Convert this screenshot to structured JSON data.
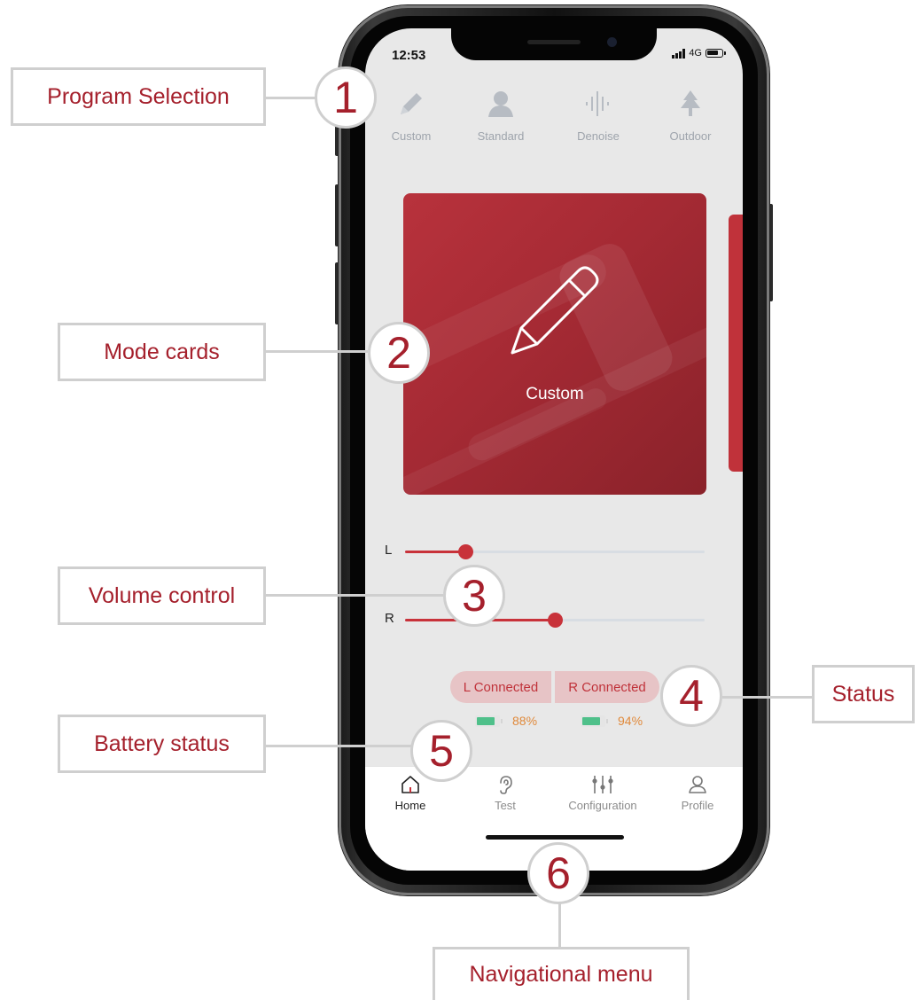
{
  "status_bar": {
    "time": "12:53",
    "network": "4G"
  },
  "programs": [
    {
      "label": "Custom",
      "icon": "pencil-icon"
    },
    {
      "label": "Standard",
      "icon": "person-icon"
    },
    {
      "label": "Denoise",
      "icon": "waveform-icon"
    },
    {
      "label": "Outdoor",
      "icon": "tree-icon"
    }
  ],
  "mode_card": {
    "label": "Custom",
    "icon": "pencil-icon"
  },
  "volume": {
    "left": {
      "label": "L",
      "level": 0.2
    },
    "right": {
      "label": "R",
      "level": 0.5
    }
  },
  "status": {
    "left_label": "L Connected",
    "right_label": "R Connected",
    "left_battery": "88%",
    "right_battery": "94%"
  },
  "nav": [
    {
      "label": "Home",
      "icon": "home-icon",
      "active": true
    },
    {
      "label": "Test",
      "icon": "ear-icon",
      "active": false
    },
    {
      "label": "Configuration",
      "icon": "sliders-icon",
      "active": false
    },
    {
      "label": "Profile",
      "icon": "user-icon",
      "active": false
    }
  ],
  "callouts": {
    "program_selection": {
      "number": "1",
      "label": "Program Selection"
    },
    "mode_cards": {
      "number": "2",
      "label": "Mode cards"
    },
    "volume_control": {
      "number": "3",
      "label": "Volume control"
    },
    "status": {
      "number": "4",
      "label": "Status"
    },
    "battery_status": {
      "number": "5",
      "label": "Battery status"
    },
    "navigational_menu": {
      "number": "6",
      "label": "Navigational menu"
    }
  },
  "colors": {
    "accent": "#c8323a",
    "callout_text": "#a5202c",
    "callout_border": "#cfcfcf",
    "battery_green": "#4fc08a",
    "battery_text": "#e08a3c"
  }
}
